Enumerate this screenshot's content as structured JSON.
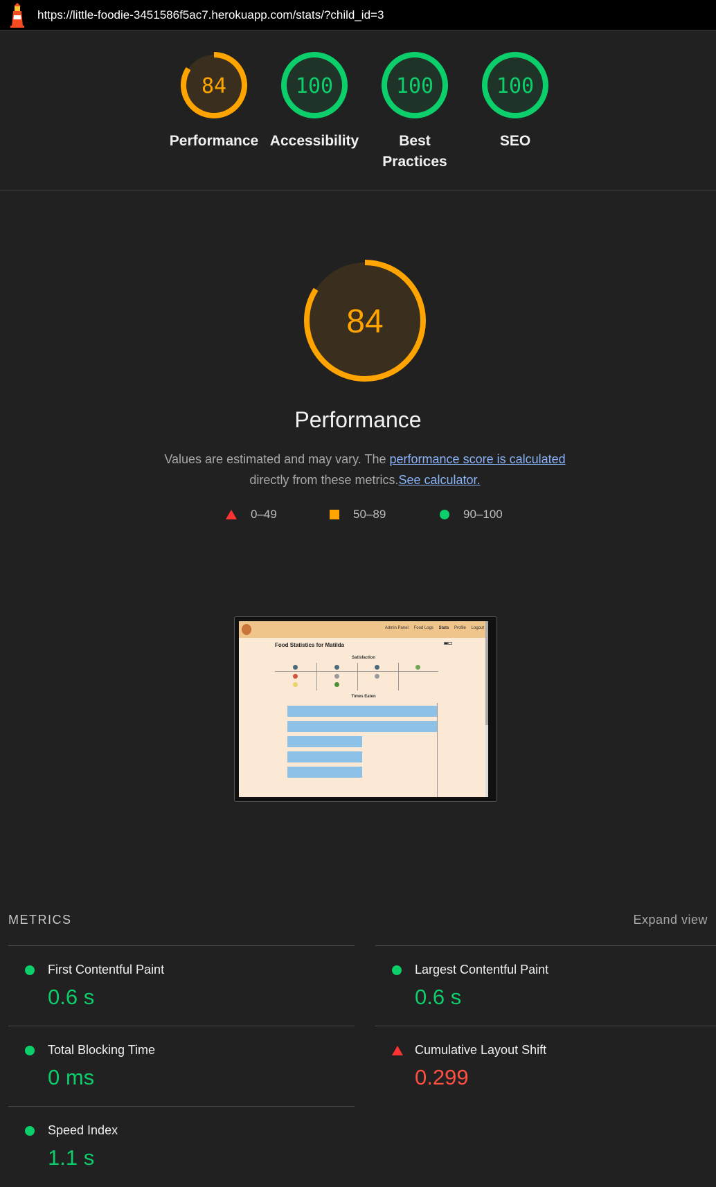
{
  "url": "https://little-foodie-3451586f5ac7.herokuapp.com/stats/?child_id=3",
  "colors": {
    "pass": "#0cce6b",
    "average": "#ffa400",
    "fail": "#ff3333"
  },
  "gauges": [
    {
      "label": "Performance",
      "score": "84",
      "value": 84,
      "status": "average"
    },
    {
      "label": "Accessibility",
      "score": "100",
      "value": 100,
      "status": "pass"
    },
    {
      "label": "Best Practices",
      "score": "100",
      "value": 100,
      "status": "pass"
    },
    {
      "label": "SEO",
      "score": "100",
      "value": 100,
      "status": "pass"
    }
  ],
  "performance": {
    "score": "84",
    "value": 84,
    "title": "Performance",
    "desc_prefix": "Values are estimated and may vary. The ",
    "desc_link": "performance score is calculated",
    "desc_mid": "directly from these metrics.",
    "desc_link2": "See calculator."
  },
  "legend": [
    {
      "shape": "triangle",
      "range": "0–49"
    },
    {
      "shape": "square",
      "range": "50–89"
    },
    {
      "shape": "circle",
      "range": "90–100"
    }
  ],
  "thumbnail": {
    "nav": [
      "Admin Panel",
      "Food Logs",
      "Stats",
      "Profile",
      "Logout"
    ],
    "heading": "Food Statistics for Matilda",
    "section1": "Satisfaction",
    "section2": "Times Eaten",
    "bar_values": [
      1,
      1,
      0.5,
      0.5,
      0.5
    ]
  },
  "metrics_header": "METRICS",
  "expand_label": "Expand view",
  "metrics": [
    {
      "name": "First Contentful Paint",
      "value": "0.6 s",
      "status": "pass"
    },
    {
      "name": "Largest Contentful Paint",
      "value": "0.6 s",
      "status": "pass"
    },
    {
      "name": "Total Blocking Time",
      "value": "0 ms",
      "status": "pass"
    },
    {
      "name": "Cumulative Layout Shift",
      "value": "0.299",
      "status": "fail"
    },
    {
      "name": "Speed Index",
      "value": "1.1 s",
      "status": "pass"
    }
  ]
}
